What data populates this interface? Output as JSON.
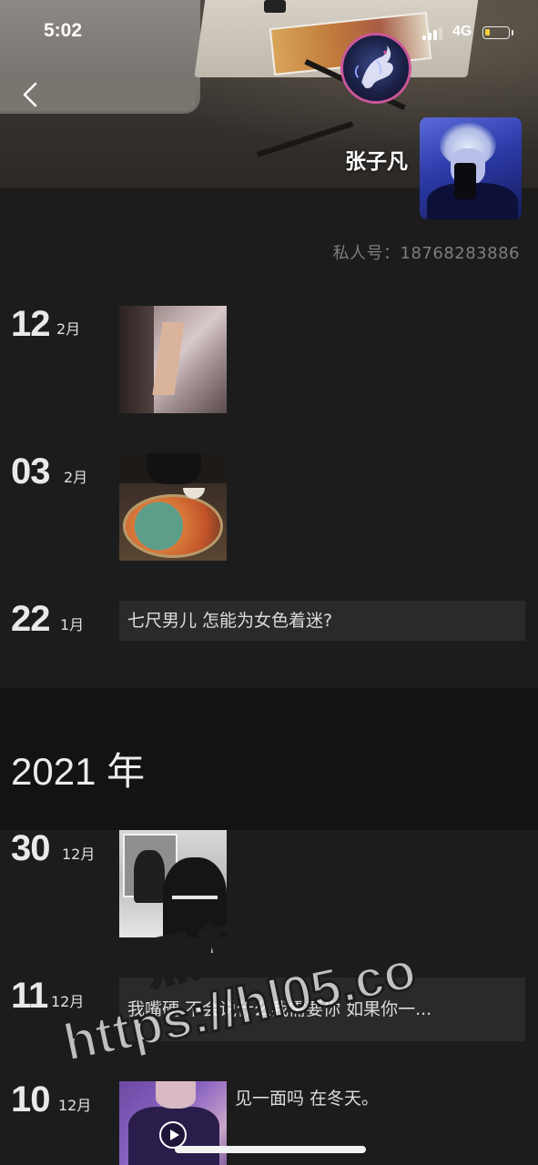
{
  "status_bar": {
    "time": "5:02",
    "network": "4G",
    "battery_level": 0.2,
    "battery_color": "#f4d03f"
  },
  "header": {
    "back_icon": "chevron-left-icon",
    "badge_icon": "dragon-emblem-icon"
  },
  "profile": {
    "name": "张子凡",
    "private_number": "私人号：18768283886"
  },
  "timeline": [
    {
      "day": "12",
      "month": "2月",
      "type": "photo",
      "photo": "shirt-photo"
    },
    {
      "day": "03",
      "month": "2月",
      "type": "photo",
      "photo": "hotpot-photo"
    },
    {
      "day": "22",
      "month": "1月",
      "type": "text",
      "text": "七尺男儿 怎能为女色着迷?"
    }
  ],
  "year_section": {
    "label": "2021 年",
    "entries": [
      {
        "day": "30",
        "month": "12月",
        "type": "photo",
        "photo": "mirror-selfie-photo"
      },
      {
        "day": "11",
        "month": "12月",
        "type": "text",
        "text": "我嘴硬 不会说什么我需要你 如果你一..."
      },
      {
        "day": "10",
        "month": "12月",
        "type": "video",
        "photo": "purple-video-thumbnail",
        "caption": "见一面吗 在冬天。"
      }
    ]
  },
  "watermark": {
    "line1": "黑料网",
    "line2": "https://hl05.co"
  },
  "colors": {
    "background": "#1c1c1c",
    "section_gap": "#131313",
    "text_box": "#2a2a2a",
    "muted_text": "#7d7d7d",
    "badge_ring": "#c9569a"
  }
}
